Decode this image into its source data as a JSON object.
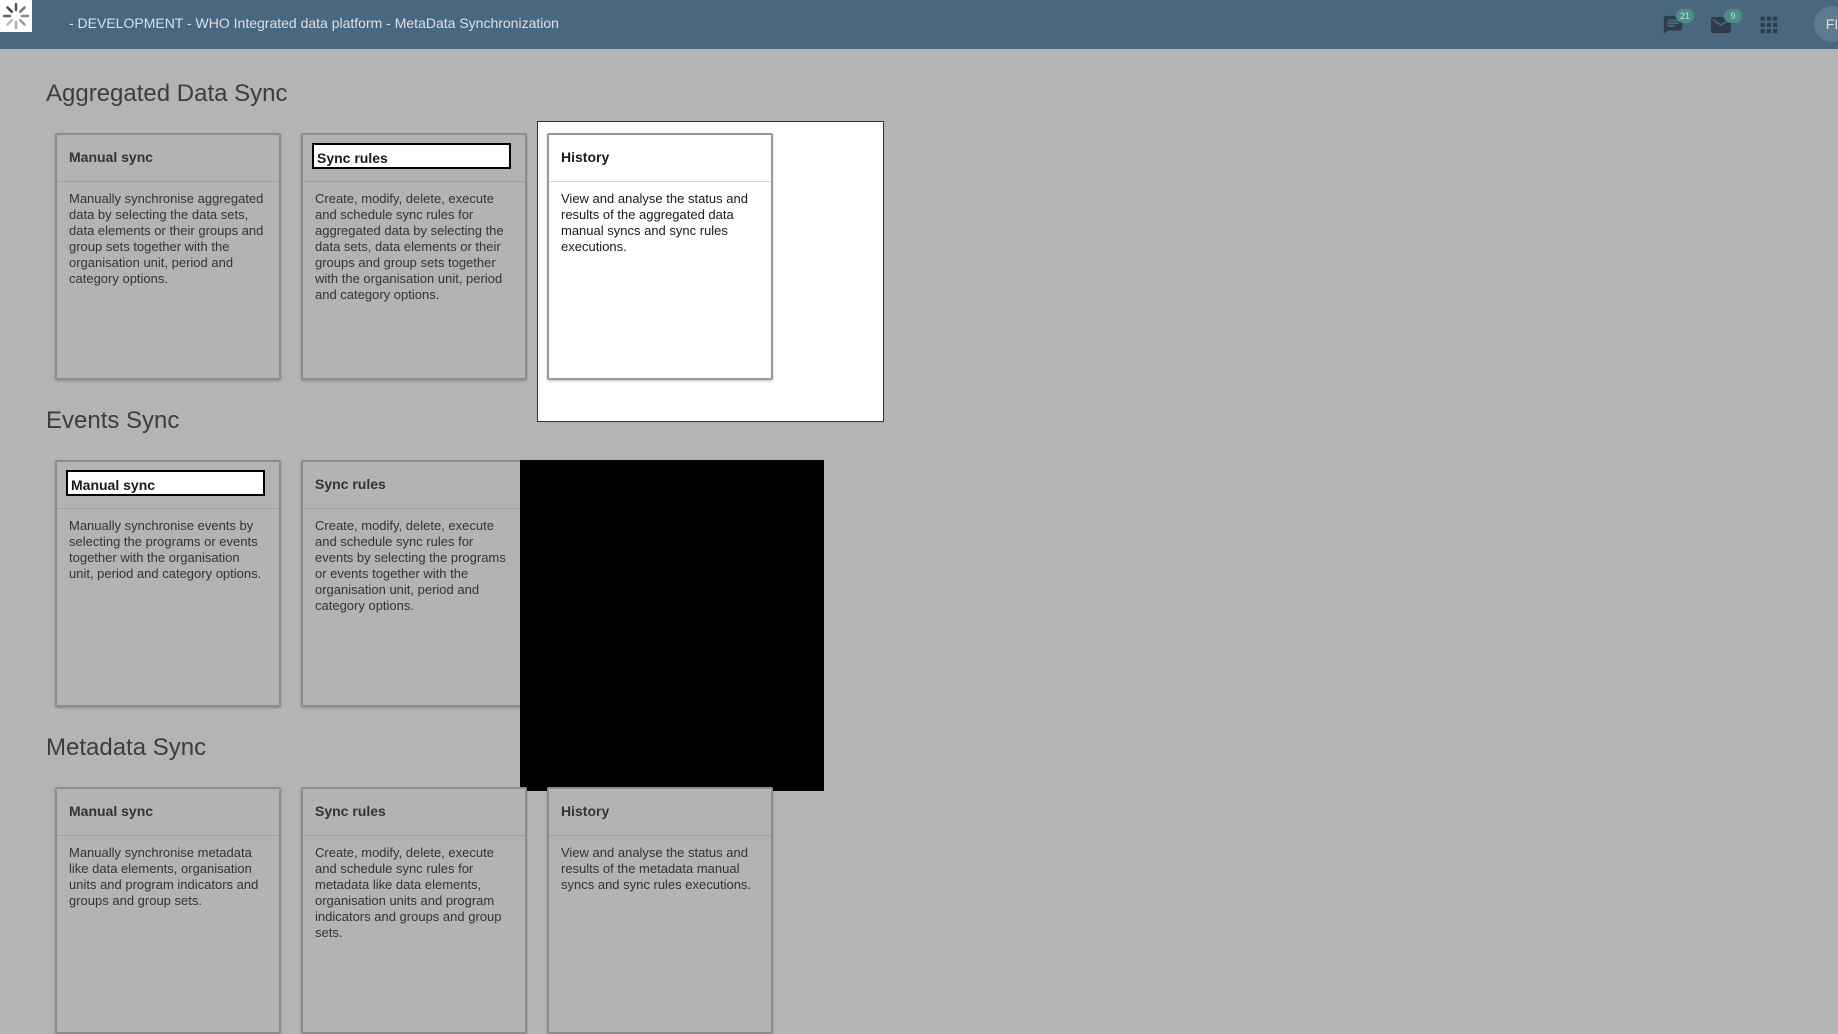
{
  "header": {
    "title": "- DEVELOPMENT - WHO Integrated data platform - MetaData Synchronization",
    "messages_count": "21",
    "mail_count": "9",
    "apps_icon": "apps-grid-icon",
    "avatar_initials": "FI"
  },
  "sections": [
    {
      "title": "Aggregated Data Sync",
      "cards": [
        {
          "title": "Manual sync",
          "description": "Manually synchronise aggregated data by selecting the data sets, data elements or their groups and group sets together with the organisation unit, period and category options."
        },
        {
          "title": "Sync rules",
          "description": "Create, modify, delete, execute and schedule sync rules for aggregated data by selecting the data sets, data elements or their groups and group sets together with the organisation unit, period and category options."
        },
        {
          "title": "History",
          "description": "View and analyse the status and results of the aggregated data manual syncs and sync rules executions."
        }
      ]
    },
    {
      "title": "Events Sync",
      "cards": [
        {
          "title": "Manual sync",
          "description": "Manually synchronise events by selecting the programs or events together with the organisation unit, period and category options."
        },
        {
          "title": "Sync rules",
          "description": "Create, modify, delete, execute and schedule sync rules for events by selecting the programs or events together with the organisation unit, period and category options."
        }
      ]
    },
    {
      "title": "Metadata Sync",
      "cards": [
        {
          "title": "Manual sync",
          "description": "Manually synchronise metadata like data elements, organisation units and program indicators and groups and group sets."
        },
        {
          "title": "Sync rules",
          "description": "Create, modify, delete, execute and schedule sync rules for metadata like data elements, organisation units and program indicators and groups and group sets."
        },
        {
          "title": "History",
          "description": "View and analyse the status and results of the metadata manual syncs and sync rules executions."
        }
      ]
    }
  ]
}
